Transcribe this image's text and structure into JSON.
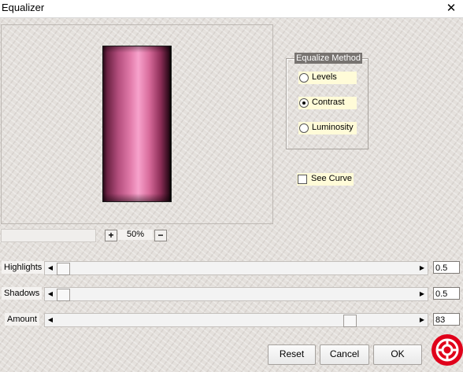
{
  "window": {
    "title": "Equalizer",
    "close_glyph": "✕"
  },
  "method_group": {
    "legend": "Equalize Method",
    "options": [
      {
        "label": "Levels",
        "selected": false
      },
      {
        "label": "Contrast",
        "selected": true
      },
      {
        "label": "Luminosity",
        "selected": false
      }
    ]
  },
  "see_curve": {
    "label": "See Curve",
    "checked": false
  },
  "zoom": {
    "plus": "+",
    "minus": "−",
    "value": "50%"
  },
  "sliders": [
    {
      "label": "Highlights",
      "value": "0.5",
      "fraction": 0.0
    },
    {
      "label": "Shadows",
      "value": "0.5",
      "fraction": 0.0
    },
    {
      "label": "Amount",
      "value": "83",
      "fraction": 0.83
    }
  ],
  "arrows": {
    "left": "◀",
    "right": "▶"
  },
  "buttons": {
    "reset": "Reset",
    "cancel": "Cancel",
    "ok": "OK"
  },
  "icons": {
    "help": "lifebuoy-help-icon",
    "close": "close-icon"
  },
  "colors": {
    "help_red": "#e0001a",
    "radio_bg": "#fffbd8",
    "legend_bg": "#777370"
  }
}
